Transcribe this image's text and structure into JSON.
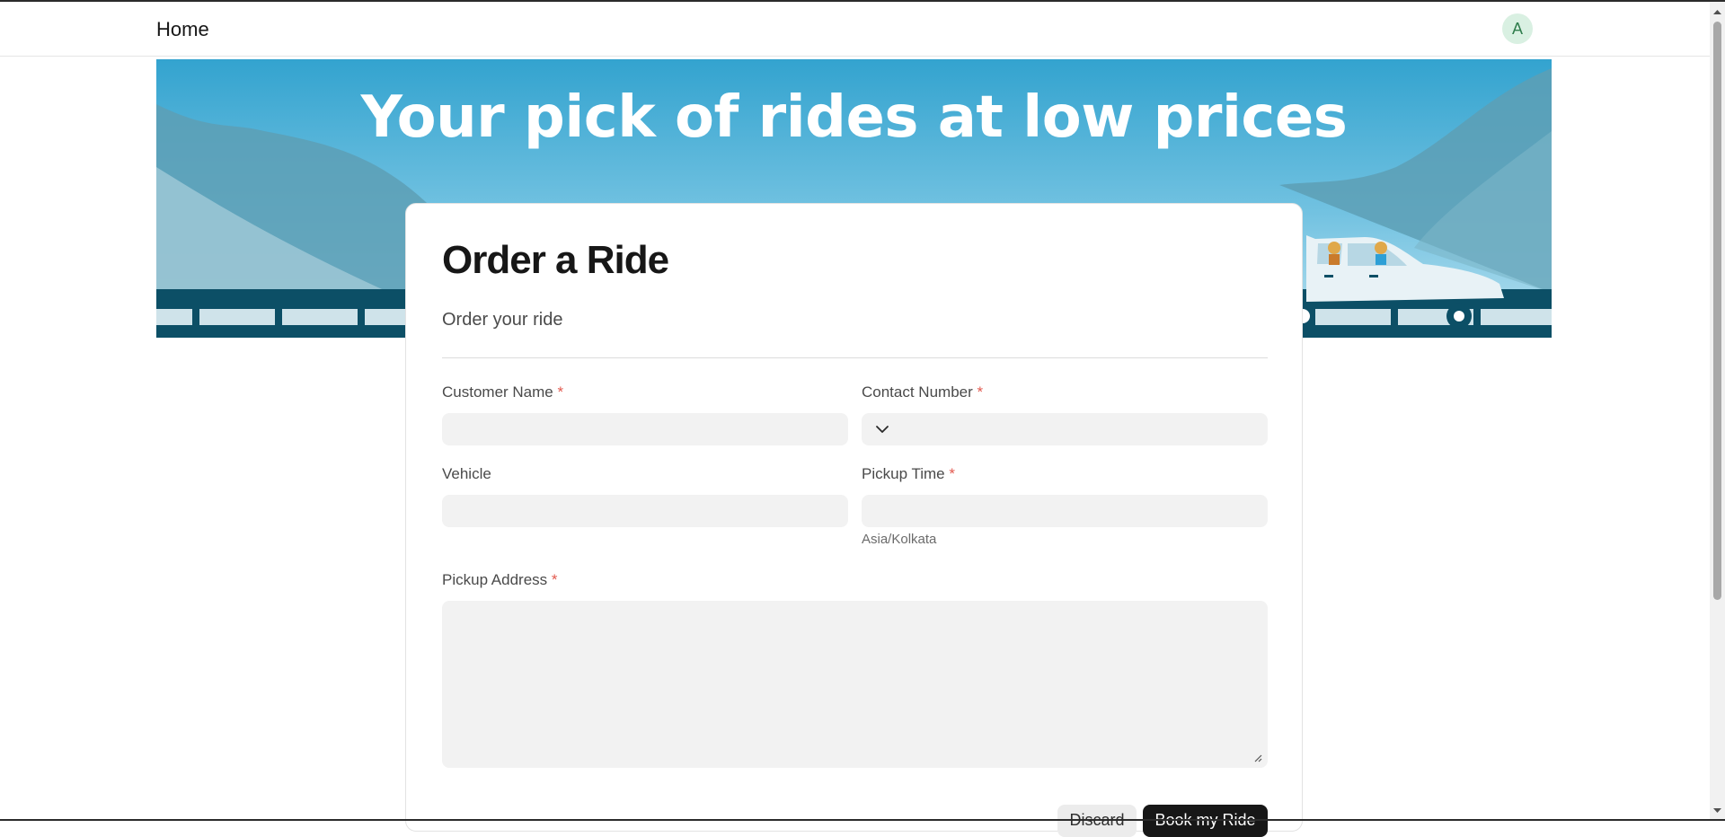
{
  "nav": {
    "home_label": "Home",
    "avatar_initial": "A"
  },
  "banner": {
    "headline": "Your pick of rides at low prices"
  },
  "form": {
    "title": "Order a Ride",
    "subtitle": "Order your ride",
    "required_mark": "*",
    "fields": {
      "customer_name": {
        "label": "Customer Name",
        "value": ""
      },
      "contact_number": {
        "label": "Contact Number",
        "value": ""
      },
      "vehicle": {
        "label": "Vehicle",
        "value": ""
      },
      "pickup_time": {
        "label": "Pickup Time",
        "value": "",
        "timezone": "Asia/Kolkata"
      },
      "pickup_address": {
        "label": "Pickup Address",
        "value": ""
      }
    },
    "buttons": {
      "discard": "Discard",
      "submit": "Book my Ride"
    }
  },
  "colors": {
    "accent": "#171717",
    "required": "#e25a4f",
    "banner_sky": "#3aa7d0",
    "avatar_bg": "#d9f0e2"
  },
  "icons": [
    "chevron-down-icon",
    "resize-grip-icon",
    "scroll-up-icon",
    "scroll-down-icon"
  ]
}
